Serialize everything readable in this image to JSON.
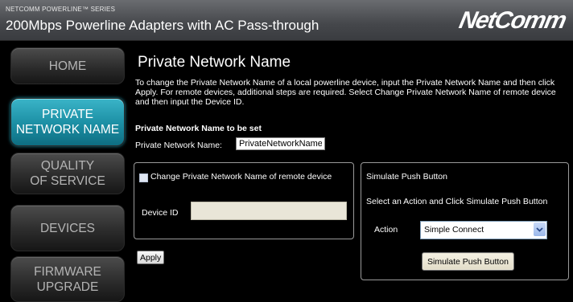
{
  "header": {
    "series": "NETCOMM POWERLINE™ SERIES",
    "product": "200Mbps Powerline Adapters with AC Pass-through",
    "logo": "NetComm"
  },
  "sidebar": {
    "items": [
      {
        "line1": "HOME",
        "line2": ""
      },
      {
        "line1": "PRIVATE",
        "line2": "NETWORK NAME"
      },
      {
        "line1": "QUALITY",
        "line2": "OF SERVICE"
      },
      {
        "line1": "DEVICES",
        "line2": ""
      },
      {
        "line1": "FIRMWARE",
        "line2": "UPGRADE"
      }
    ],
    "active_color": "#1b8ea3"
  },
  "main": {
    "title": "Private Network Name",
    "description": "To change the Private Network Name of a local powerline device, input the Private Network Name and then click Apply. For remote devices, additional steps are required. Select Change Private Network Name of remote device and then input the Device ID.",
    "section_heading": "Private Network Name to be set",
    "pnn_label": "Private Network Name:",
    "pnn_value": "PrivateNetworkName",
    "remote": {
      "checkbox_label": "Change Private Network Name of remote device",
      "checked": false,
      "device_id_label": "Device ID",
      "device_id_value": ""
    },
    "apply_label": "Apply",
    "push": {
      "title": "Simulate Push Button",
      "instruction": "Select an Action and Click Simulate Push Button",
      "action_label": "Action",
      "action_value": "Simple Connect",
      "button_label": "Simulate Push Button"
    }
  }
}
